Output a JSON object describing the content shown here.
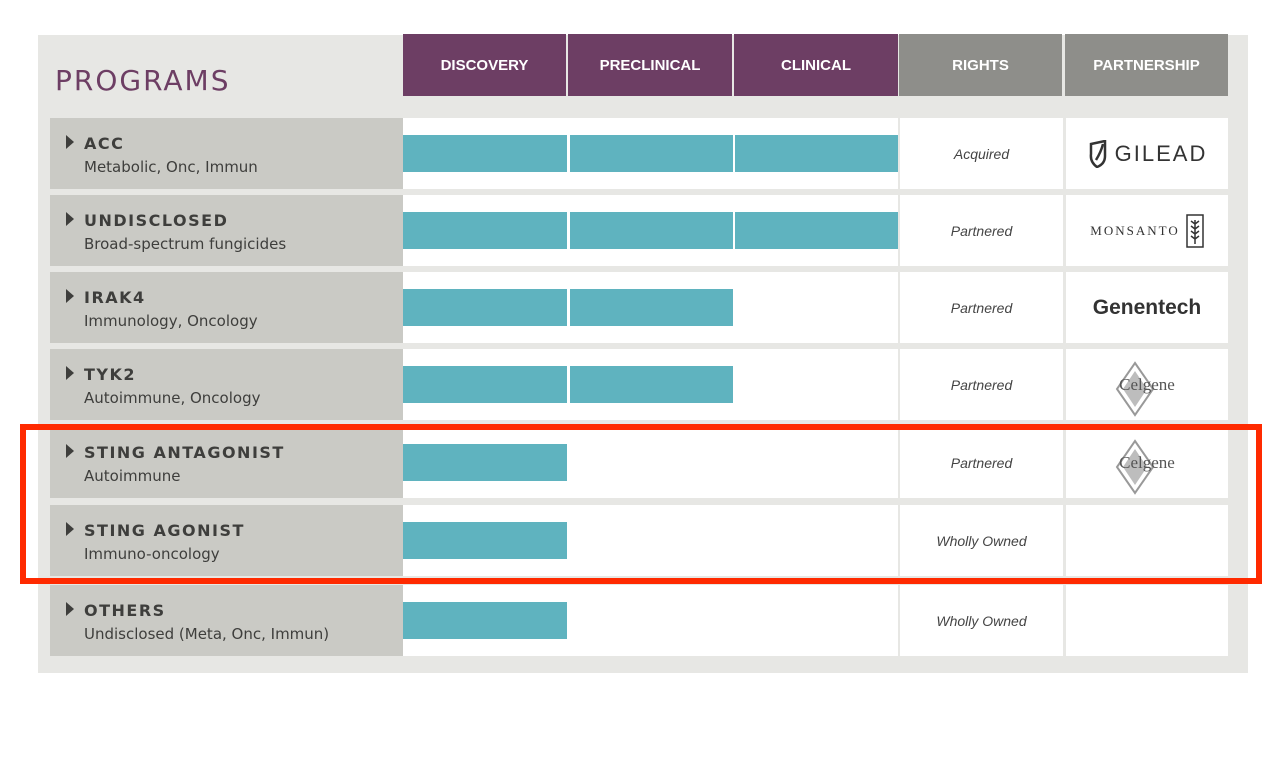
{
  "header": {
    "title": "PROGRAMS",
    "stages": [
      "DISCOVERY",
      "PRECLINICAL",
      "CLINICAL"
    ],
    "rights_label": "RIGHTS",
    "partnership_label": "PARTNERSHIP"
  },
  "rows": [
    {
      "name": "ACC",
      "subtitle": "Metabolic, Onc, Immun",
      "stage_progress": 3,
      "rights": "Acquired",
      "partner": "GILEAD"
    },
    {
      "name": "UNDISCLOSED",
      "subtitle": "Broad-spectrum fungicides",
      "stage_progress": 3,
      "rights": "Partnered",
      "partner": "MONSANTO"
    },
    {
      "name": "IRAK4",
      "subtitle": "Immunology, Oncology",
      "stage_progress": 2,
      "rights": "Partnered",
      "partner": "Genentech"
    },
    {
      "name": "TYK2",
      "subtitle": "Autoimmune, Oncology",
      "stage_progress": 2,
      "rights": "Partnered",
      "partner": "Celgene"
    },
    {
      "name": "STING ANTAGONIST",
      "subtitle": "Autoimmune",
      "stage_progress": 1,
      "rights": "Partnered",
      "partner": "Celgene"
    },
    {
      "name": "STING AGONIST",
      "subtitle": "Immuno-oncology",
      "stage_progress": 1,
      "rights": "Wholly Owned",
      "partner": ""
    },
    {
      "name": "OTHERS",
      "subtitle": "Undisclosed (Meta, Onc, Immun)",
      "stage_progress": 1,
      "rights": "Wholly Owned",
      "partner": ""
    }
  ],
  "colors": {
    "stage_header": "#6d3e64",
    "aux_header": "#8e8e8a",
    "bar": "#5fb3bf",
    "row_label_bg": "#cacac5",
    "highlight": "#ff2a00"
  }
}
